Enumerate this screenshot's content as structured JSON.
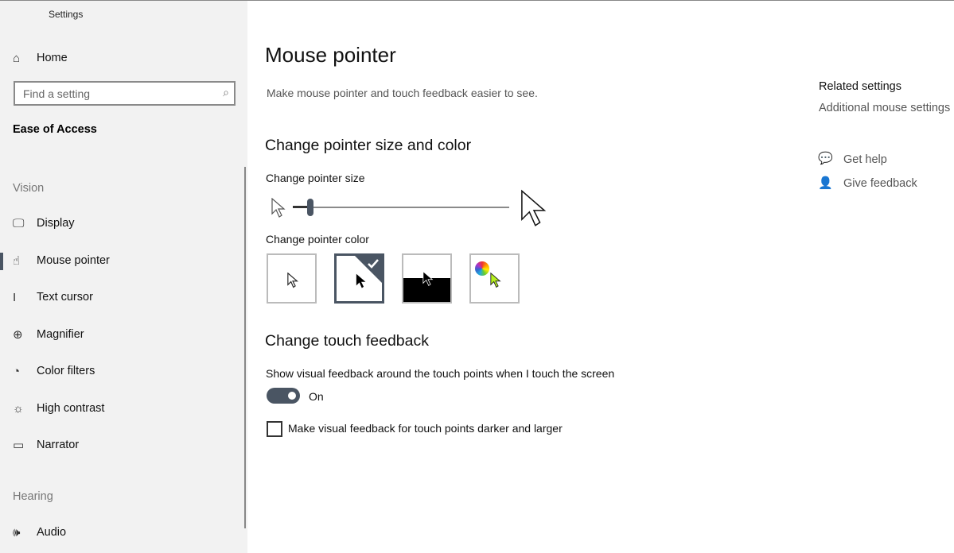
{
  "window": {
    "title": "Settings"
  },
  "sidebar": {
    "home": "Home",
    "search_placeholder": "Find a setting",
    "section": "Ease of Access",
    "groups": {
      "vision": "Vision",
      "hearing": "Hearing"
    },
    "items": [
      {
        "label": "Display",
        "icon": "monitor-icon"
      },
      {
        "label": "Mouse pointer",
        "icon": "mouse-pointer-icon",
        "selected": true
      },
      {
        "label": "Text cursor",
        "icon": "text-cursor-icon"
      },
      {
        "label": "Magnifier",
        "icon": "magnifier-icon"
      },
      {
        "label": "Color filters",
        "icon": "palette-icon"
      },
      {
        "label": "High contrast",
        "icon": "sun-icon"
      },
      {
        "label": "Narrator",
        "icon": "narrator-icon"
      },
      {
        "label": "Audio",
        "icon": "speaker-icon"
      }
    ]
  },
  "main": {
    "title": "Mouse pointer",
    "subtitle": "Make mouse pointer and touch feedback easier to see.",
    "section1": "Change pointer size and color",
    "size_label": "Change pointer size",
    "size_fraction": 0.08,
    "color_label": "Change pointer color",
    "color_options": [
      "white",
      "black",
      "inverted",
      "custom"
    ],
    "selected_color": "black",
    "section2": "Change touch feedback",
    "touch_label": "Show visual feedback around the touch points when I touch the screen",
    "toggle_state": "On",
    "checkbox_label": "Make visual feedback for touch points darker and larger",
    "checkbox_checked": false,
    "accent": "#4a5563"
  },
  "related": {
    "title": "Related settings",
    "link": "Additional mouse settings",
    "help": "Get help",
    "feedback": "Give feedback"
  }
}
